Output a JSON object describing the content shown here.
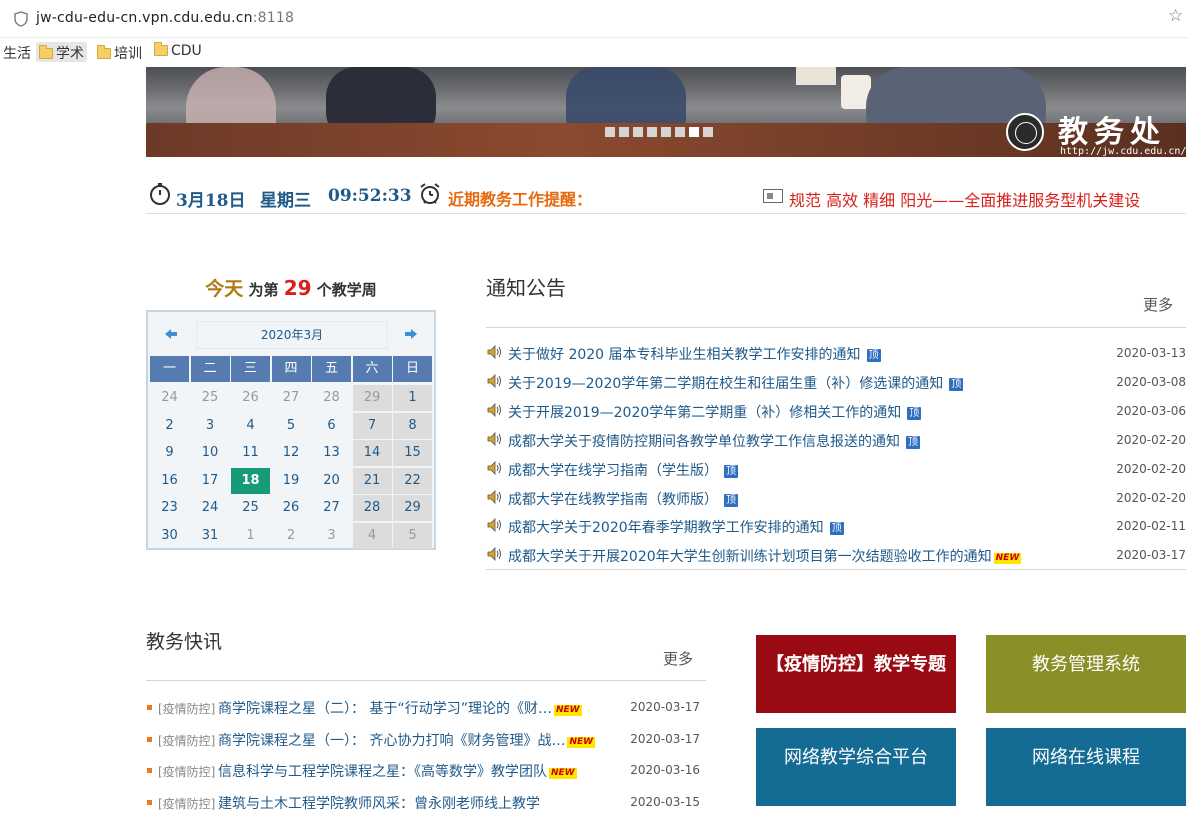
{
  "browser": {
    "url_host": "jw-cdu-edu-cn.vpn.cdu.edu.cn",
    "url_port": ":8118",
    "bookmarks": [
      "生活",
      "学术",
      "培训",
      "CDU"
    ]
  },
  "banner": {
    "logo_text": "教务处",
    "logo_url": "http://jw.cdu.edu.cn/",
    "slide_count": 8,
    "active_slide": 7
  },
  "timebar": {
    "date": "3月18日",
    "weekday": "星期三",
    "time": "09:52:33",
    "reminder_label": "近期教务工作提醒：",
    "slogan": "规范 高效 精细 阳光——全面推进服务型机关建设"
  },
  "week_info": {
    "today": "今天",
    "prefix": "为第",
    "week_number": "29",
    "suffix": "个教学周"
  },
  "calendar": {
    "title": "2020年3月",
    "weekdays": [
      "一",
      "二",
      "三",
      "四",
      "五",
      "六",
      "日"
    ],
    "days": [
      [
        "24",
        "25",
        "26",
        "27",
        "28",
        "29",
        "1"
      ],
      [
        "2",
        "3",
        "4",
        "5",
        "6",
        "7",
        "8"
      ],
      [
        "9",
        "10",
        "11",
        "12",
        "13",
        "14",
        "15"
      ],
      [
        "16",
        "17",
        "18",
        "19",
        "20",
        "21",
        "22"
      ],
      [
        "23",
        "24",
        "25",
        "26",
        "27",
        "28",
        "29"
      ],
      [
        "30",
        "31",
        "1",
        "2",
        "3",
        "4",
        "5"
      ]
    ],
    "today": "18"
  },
  "notices": {
    "title": "通知公告",
    "more": "更多",
    "items": [
      {
        "text": "关于做好 2020 届本专科毕业生相关教学工作安排的通知",
        "date": "2020-03-13",
        "badge": "顶"
      },
      {
        "text": "关于2019—2020学年第二学期在校生和往届生重（补）修选课的通知",
        "date": "2020-03-08",
        "badge": "顶"
      },
      {
        "text": "关于开展2019—2020学年第二学期重（补）修相关工作的通知",
        "date": "2020-03-06",
        "badge": "顶"
      },
      {
        "text": "成都大学关于疫情防控期间各教学单位教学工作信息报送的通知",
        "date": "2020-02-20",
        "badge": "顶"
      },
      {
        "text": "成都大学在线学习指南（学生版）",
        "date": "2020-02-20",
        "badge": "顶"
      },
      {
        "text": "成都大学在线教学指南（教师版）",
        "date": "2020-02-20",
        "badge": "顶"
      },
      {
        "text": "成都大学关于2020年春季学期教学工作安排的通知",
        "date": "2020-02-11",
        "badge": "顶"
      },
      {
        "text": "成都大学关于开展2020年大学生创新训练计划项目第一次结题验收工作的通知",
        "date": "2020-03-17",
        "badge": "NEW"
      }
    ]
  },
  "news": {
    "title": "教务快讯",
    "more": "更多",
    "items": [
      {
        "category": "[疫情防控]",
        "text": "商学院课程之星（二）： 基于“行动学习”理论的《财…",
        "date": "2020-03-17",
        "badge": "NEW"
      },
      {
        "category": "[疫情防控]",
        "text": "商学院课程之星（一）： 齐心协力打响《财务管理》战…",
        "date": "2020-03-17",
        "badge": "NEW"
      },
      {
        "category": "[疫情防控]",
        "text": "信息科学与工程学院课程之星：《高等数学》教学团队",
        "date": "2020-03-16",
        "badge": "NEW"
      },
      {
        "category": "[疫情防控]",
        "text": "建筑与土木工程学院教师风采：曾永刚老师线上教学",
        "date": "2020-03-15",
        "badge": ""
      }
    ]
  },
  "tiles": [
    {
      "label": "【疫情防控】教学专题",
      "color": "#9a0a12"
    },
    {
      "label": "教务管理系统",
      "color": "#8a8f28"
    },
    {
      "label": "网络教学综合平台",
      "color": "#146c95"
    },
    {
      "label": "网络在线课程",
      "color": "#146c95"
    }
  ]
}
